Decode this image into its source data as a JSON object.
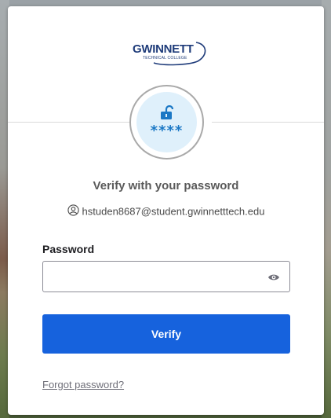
{
  "logo": {
    "name": "GWINNETT",
    "tagline": "TECHNICAL COLLEGE",
    "color": "#1f3c7a"
  },
  "authenticator": {
    "masked_text": "****",
    "icon": "unlock-icon",
    "accent": "#1b78c5",
    "circle_bg": "#dff0fb"
  },
  "page": {
    "title": "Verify with your password",
    "user_icon": "user-icon",
    "email": "hstuden8687@student.gwinnetttech.edu"
  },
  "form": {
    "password_label": "Password",
    "password_value": "",
    "password_placeholder": "",
    "reveal_icon": "eye-icon",
    "verify_label": "Verify",
    "verify_color": "#1662dd",
    "forgot_label": "Forgot password?"
  }
}
